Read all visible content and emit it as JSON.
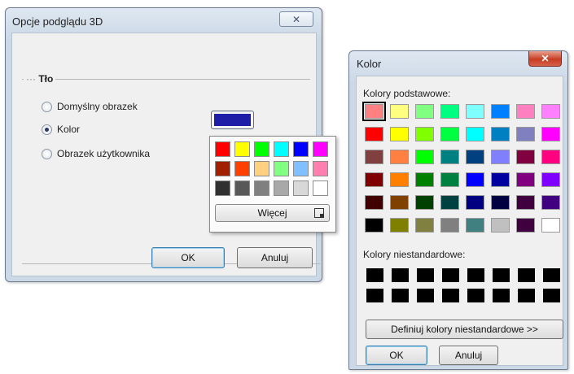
{
  "win1": {
    "title": "Opcje podglądu 3D",
    "close_glyph": "✕",
    "group_label": "Tło",
    "radios": [
      {
        "label": "Domyślny obrazek",
        "checked": false
      },
      {
        "label": "Kolor",
        "checked": true
      },
      {
        "label": "Obrazek użytkownika",
        "checked": false
      }
    ],
    "selected_color": "#1e1fa6",
    "ok_label": "OK",
    "cancel_label": "Anuluj"
  },
  "popup": {
    "colors": [
      "#ff0000",
      "#ffff00",
      "#00ff00",
      "#00ffff",
      "#0000ff",
      "#ff00ff",
      "#a02000",
      "#ff4000",
      "#ffd080",
      "#80ff80",
      "#80c0ff",
      "#ff80b0",
      "#303030",
      "#585858",
      "#808080",
      "#a8a8a8",
      "#d8d8d8",
      "#ffffff"
    ],
    "more_label": "Więcej"
  },
  "win2": {
    "title": "Kolor",
    "close_glyph": "✕",
    "basic_label": "Kolory podstawowe:",
    "basic_colors": [
      "#ff8080",
      "#ffff80",
      "#80ff80",
      "#00ff80",
      "#80ffff",
      "#0080ff",
      "#ff80c0",
      "#ff80ff",
      "#ff0000",
      "#ffff00",
      "#80ff00",
      "#00ff40",
      "#00ffff",
      "#0080c0",
      "#8080c0",
      "#ff00ff",
      "#804040",
      "#ff8040",
      "#00ff00",
      "#008080",
      "#004080",
      "#8080ff",
      "#800040",
      "#ff0080",
      "#800000",
      "#ff8000",
      "#008000",
      "#008040",
      "#0000ff",
      "#0000a0",
      "#800080",
      "#8000ff",
      "#400000",
      "#804000",
      "#004000",
      "#004040",
      "#000080",
      "#000040",
      "#400040",
      "#400080",
      "#000000",
      "#808000",
      "#808040",
      "#808080",
      "#408080",
      "#c0c0c0",
      "#400040",
      "#ffffff"
    ],
    "selected_index": 0,
    "custom_label": "Kolory niestandardowe:",
    "custom_count": 16,
    "define_label": "Definiuj kolory niestandardowe >>",
    "ok_label": "OK",
    "cancel_label": "Anuluj"
  }
}
